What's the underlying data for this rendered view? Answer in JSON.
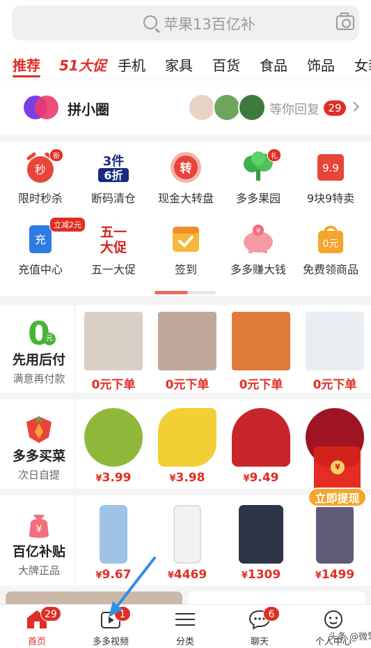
{
  "search": {
    "placeholder": "苹果13百亿补"
  },
  "tabs": [
    {
      "label": "推荐",
      "state": "active"
    },
    {
      "label": "51大促",
      "state": "promo"
    },
    {
      "label": "手机"
    },
    {
      "label": "家具"
    },
    {
      "label": "百货"
    },
    {
      "label": "食品"
    },
    {
      "label": "饰品"
    },
    {
      "label": "女装"
    }
  ],
  "circle": {
    "title": "拼小圈",
    "waiting_text": "等你回复",
    "badge_count": "29"
  },
  "grid": [
    {
      "label": "限时秒杀",
      "icon": "alarm-clock-icon",
      "icon_text": "秒",
      "badge": "新"
    },
    {
      "label": "断码清仓",
      "icon": "discount-tag-icon",
      "icon_text_top": "3件",
      "icon_text_bottom": "6折"
    },
    {
      "label": "现金大转盘",
      "icon": "wheel-icon",
      "icon_text": "转"
    },
    {
      "label": "多多果园",
      "icon": "tree-icon"
    },
    {
      "label": "9块9特卖",
      "icon": "price-tag-icon",
      "icon_text": "9.9"
    },
    {
      "label": "充值中心",
      "icon": "phone-recharge-icon",
      "icon_text": "充",
      "badge": "立减2元"
    },
    {
      "label": "五一大促",
      "icon": "may-day-icon",
      "icon_text_top": "五一",
      "icon_text_bottom": "大促"
    },
    {
      "label": "签到",
      "icon": "calendar-check-icon"
    },
    {
      "label": "多多赚大钱",
      "icon": "piggy-bank-icon",
      "icon_text": "¥"
    },
    {
      "label": "免费领商品",
      "icon": "shopping-bag-icon",
      "icon_text": "0元"
    }
  ],
  "pay_later": {
    "big_number": "0",
    "unit": "元",
    "title": "先用后付",
    "subtitle": "满意再付款",
    "items": [
      {
        "price": "0元下单",
        "image": "gold-jewelry-box",
        "color": "#d9cfc4"
      },
      {
        "price": "0元下单",
        "image": "girl-with-headband",
        "color": "#bfa89a"
      },
      {
        "price": "0元下单",
        "image": "fruit-gift-box",
        "color": "#e07a3a"
      },
      {
        "price": "0元下单",
        "image": "paper-cups",
        "color": "#e8eef2"
      }
    ]
  },
  "grocery": {
    "title": "多多买菜",
    "subtitle": "次日自提",
    "items": [
      {
        "price": "3.99",
        "image": "green-plums",
        "color": "#8fb83a"
      },
      {
        "price": "3.98",
        "image": "bananas",
        "color": "#f1cf35"
      },
      {
        "price": "9.49",
        "image": "potted-roses",
        "color": "#c7252b"
      },
      {
        "price": "",
        "image": "cherries",
        "color": "#9e1423"
      }
    ]
  },
  "subsidy": {
    "title": "百亿补贴",
    "subtitle": "大牌正品",
    "items": [
      {
        "price": "9.67",
        "image": "iphone-blue",
        "color": "#9fc3e6"
      },
      {
        "price": "4469",
        "image": "iphone-white",
        "color": "#f2f2f2"
      },
      {
        "price": "1309",
        "image": "vivo-phone",
        "color": "#2c3446"
      },
      {
        "price": "1499",
        "image": "xiaomi-phone",
        "color": "#5f5a78"
      }
    ]
  },
  "currency_symbol": "¥",
  "red_packet": {
    "seal_text": "¥",
    "button_label": "立即提现"
  },
  "bottom_nav": [
    {
      "label": "首页",
      "icon": "home-icon",
      "badge": "29",
      "active": true
    },
    {
      "label": "多多视频",
      "icon": "video-play-icon",
      "badge": "1"
    },
    {
      "label": "分类",
      "icon": "category-list-icon"
    },
    {
      "label": "聊天",
      "icon": "chat-bubble-icon",
      "badge": "6"
    },
    {
      "label": "个人中心",
      "icon": "profile-icon"
    }
  ],
  "watermark": "头条 @微擎",
  "colors": {
    "brand_red": "#e02e24",
    "annotation_arrow": "#2f8fe0",
    "withdraw_orange": "#f5a52a"
  }
}
